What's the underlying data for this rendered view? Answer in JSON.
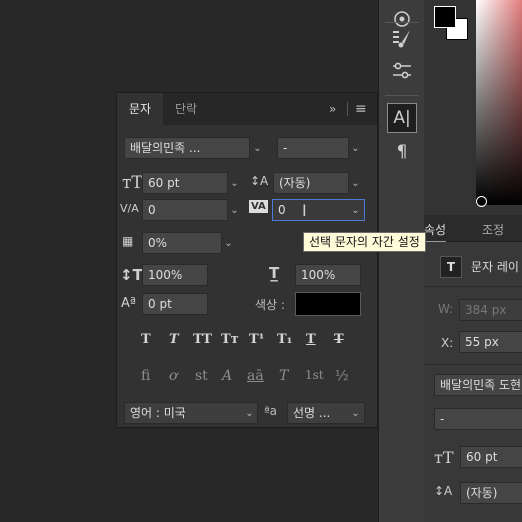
{
  "character_panel": {
    "tabs": {
      "character": "문자",
      "paragraph": "단락"
    },
    "collapse_label": "»",
    "menu_label": "≡",
    "font_family": "배달의민족 ...",
    "font_style": "-",
    "font_size": "60 pt",
    "leading": "(자동)",
    "kerning": "0",
    "tracking": "0",
    "tsume": "0%",
    "vertical_scale": "100%",
    "horizontal_scale": "100%",
    "baseline_shift": "0 pt",
    "color_label": "색상 :",
    "color_value": "#000000",
    "format_buttons": [
      "T",
      "T",
      "TT",
      "Tт",
      "T¹",
      "T₁",
      "T",
      "T"
    ],
    "opentype_buttons": [
      "fi",
      "ơ",
      "st",
      "A",
      "aā",
      "T",
      "1st",
      "½"
    ],
    "language": "영어 : 미국",
    "aa_label": "ªa",
    "antialias": "선명 ..."
  },
  "tooltip": "선택 문자의 자간 설정",
  "properties_panel": {
    "tabs": {
      "properties": "속성",
      "adjustments": "조정"
    },
    "layer_label": "문자 레이",
    "w_label": "W:",
    "w_value": "384 px",
    "x_label": "X:",
    "x_value": "55 px",
    "font_family": "배달의민족 도현",
    "font_style": "-",
    "font_size": "60 pt",
    "leading": "(자동)"
  },
  "swatches": {
    "foreground": "#000000",
    "background": "#ffffff"
  }
}
